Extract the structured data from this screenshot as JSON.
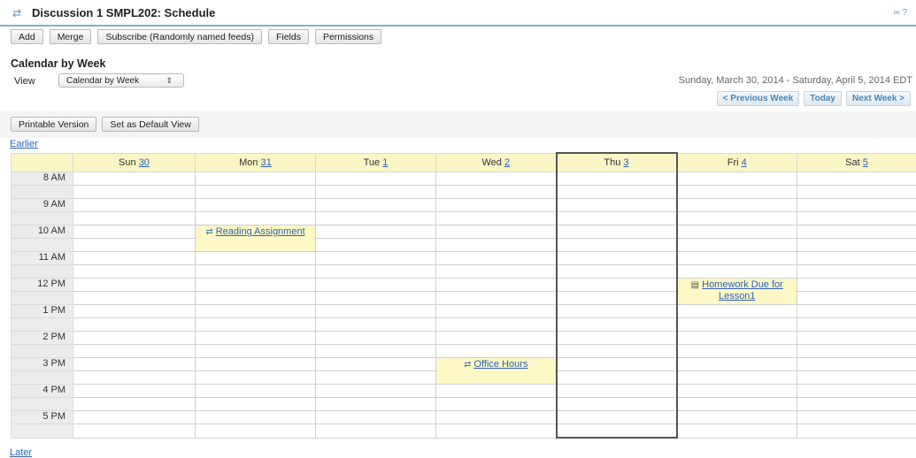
{
  "header": {
    "title": "Discussion 1 SMPL202: Schedule",
    "tools": "∞ ?"
  },
  "toolbar": {
    "add": "Add",
    "merge": "Merge",
    "subscribe": "Subscribe (Randomly named feeds)",
    "fields": "Fields",
    "permissions": "Permissions"
  },
  "section_title": "Calendar by Week",
  "view": {
    "label": "View",
    "selected": "Calendar by Week"
  },
  "date_range": "Sunday, March 30, 2014 - Saturday, April 5, 2014 EDT",
  "nav": {
    "previous": "< Previous Week",
    "today": "Today",
    "next": "Next Week >"
  },
  "print_bar": {
    "printable": "Printable Version",
    "default_view": "Set as Default View"
  },
  "links": {
    "earlier": "Earlier",
    "later": "Later"
  },
  "days": [
    {
      "name": "Sun",
      "date": "30"
    },
    {
      "name": "Mon",
      "date": "31"
    },
    {
      "name": "Tue",
      "date": "1"
    },
    {
      "name": "Wed",
      "date": "2"
    },
    {
      "name": "Thu",
      "date": "3"
    },
    {
      "name": "Fri",
      "date": "4"
    },
    {
      "name": "Sat",
      "date": "5"
    }
  ],
  "times": [
    "8 AM",
    "9 AM",
    "10 AM",
    "11 AM",
    "12 PM",
    "1 PM",
    "2 PM",
    "3 PM",
    "4 PM",
    "5 PM"
  ],
  "events": {
    "reading": "Reading Assignment",
    "homework": "Homework Due for Lesson1",
    "office": "Office Hours"
  },
  "colors": {
    "header_bg": "#faf5c4",
    "event_bg": "#fdf8c6",
    "link": "#2b62b8",
    "accent_border": "#7db3c9"
  }
}
